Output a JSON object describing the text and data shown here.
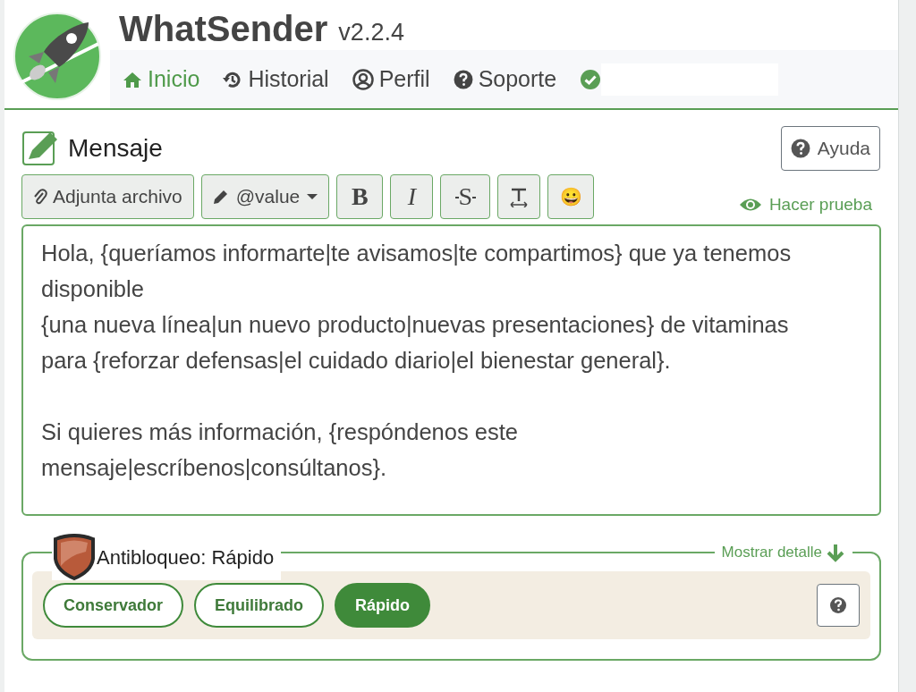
{
  "app": {
    "title": "WhatSender",
    "version": "v2.2.4"
  },
  "nav": [
    {
      "label": "Inicio",
      "kind": "home",
      "selected": true
    },
    {
      "label": "Historial",
      "kind": "history",
      "selected": false
    },
    {
      "label": "Perfil",
      "kind": "user",
      "selected": false
    },
    {
      "label": "Soporte",
      "kind": "question",
      "selected": false
    }
  ],
  "connected": true,
  "message": {
    "title": "Mensaje",
    "help_button": "Ayuda",
    "toolbar": [
      {
        "kind": "attach",
        "label": "Adjunta archivo"
      },
      {
        "kind": "variable",
        "label": "@value"
      },
      {
        "kind": "bold",
        "label": "B"
      },
      {
        "kind": "italic",
        "label": "I"
      },
      {
        "kind": "strike",
        "label": "S"
      },
      {
        "kind": "clear"
      },
      {
        "kind": "emoji",
        "label": "😀"
      }
    ],
    "test_link": "Hacer prueba",
    "text": "Hola, {queríamos informarte|te avisamos|te compartimos} que ya tenemos disponible\n{una nueva línea|un nuevo producto|nuevas presentaciones} de vitaminas para {reforzar defensas|el cuidado diario|el bienestar general}.\n\nSi quieres más información, {respóndenos este mensaje|escríbenos|consúltanos}."
  },
  "antiblock": {
    "title": "Antibloqueo: Rápido",
    "details_link": "Mostrar detalle",
    "modes": [
      {
        "label": "Conservador",
        "selected": false
      },
      {
        "label": "Equilibrado",
        "selected": false
      },
      {
        "label": "Rápido",
        "selected": true
      }
    ]
  }
}
